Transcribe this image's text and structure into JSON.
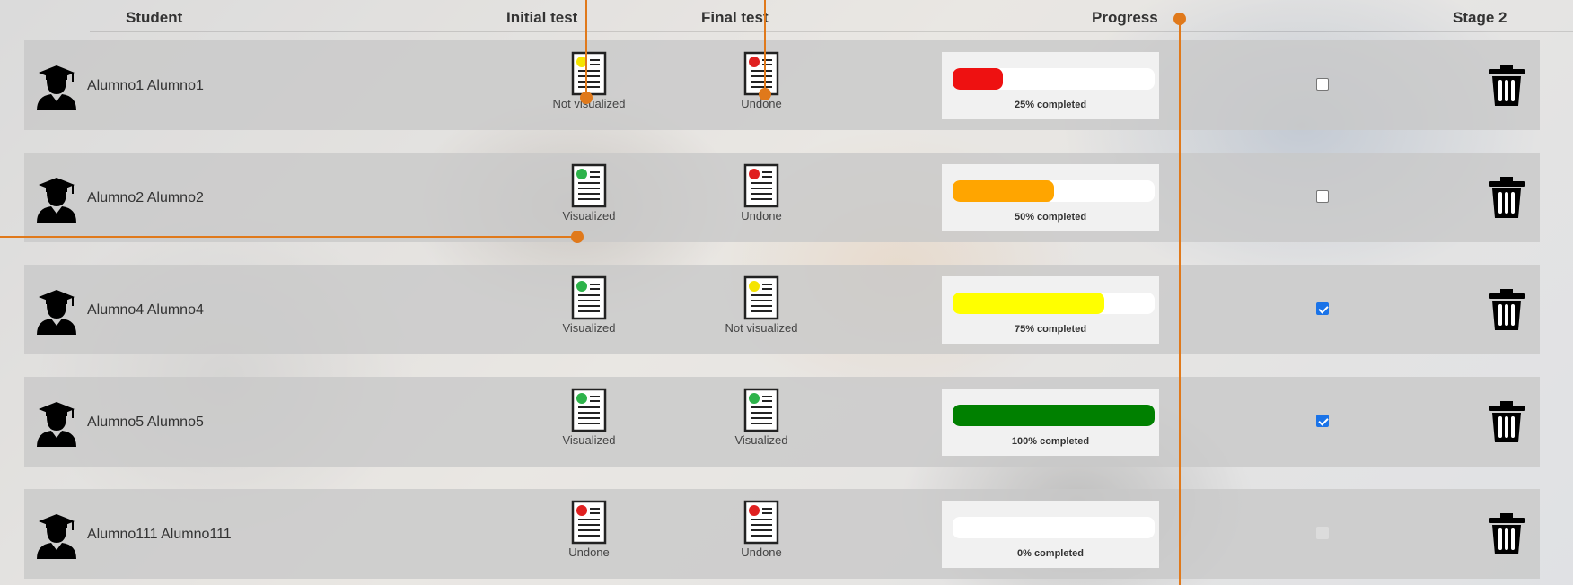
{
  "header": {
    "student": "Student",
    "initial_test": "Initial test",
    "final_test": "Final test",
    "progress": "Progress",
    "stage2": "Stage 2"
  },
  "colors": {
    "status_visualized": "#2db34a",
    "status_not_visualized": "#f5e400",
    "status_undone": "#e02020",
    "annotation": "#e0791b",
    "checkbox_checked": "#1a73e8"
  },
  "rows": [
    {
      "name": "Alumno1 Alumno1",
      "initial": {
        "label": "Not visualized",
        "status": "not_visualized"
      },
      "final": {
        "label": "Undone",
        "status": "undone"
      },
      "progress_text": "25%  completed",
      "progress_fraction": 0.25,
      "progress_color": "#ee1111",
      "stage2": "unchecked"
    },
    {
      "name": "Alumno2 Alumno2",
      "initial": {
        "label": "Visualized",
        "status": "visualized"
      },
      "final": {
        "label": "Undone",
        "status": "undone"
      },
      "progress_text": "50%  completed",
      "progress_fraction": 0.5,
      "progress_color": "#ffa500",
      "stage2": "unchecked"
    },
    {
      "name": "Alumno4 Alumno4",
      "initial": {
        "label": "Visualized",
        "status": "visualized"
      },
      "final": {
        "label": "Not visualized",
        "status": "not_visualized"
      },
      "progress_text": "75%  completed",
      "progress_fraction": 0.75,
      "progress_color": "#ffff00",
      "stage2": "checked"
    },
    {
      "name": "Alumno5 Alumno5",
      "initial": {
        "label": "Visualized",
        "status": "visualized"
      },
      "final": {
        "label": "Visualized",
        "status": "visualized"
      },
      "progress_text": "100%  completed",
      "progress_fraction": 1.0,
      "progress_color": "#008000",
      "stage2": "checked"
    },
    {
      "name": "Alumno111 Alumno111",
      "initial": {
        "label": "Undone",
        "status": "undone"
      },
      "final": {
        "label": "Undone",
        "status": "undone"
      },
      "progress_text": "0%  completed",
      "progress_fraction": 0.0,
      "progress_color": "#ffffff",
      "stage2": "disabled"
    }
  ]
}
